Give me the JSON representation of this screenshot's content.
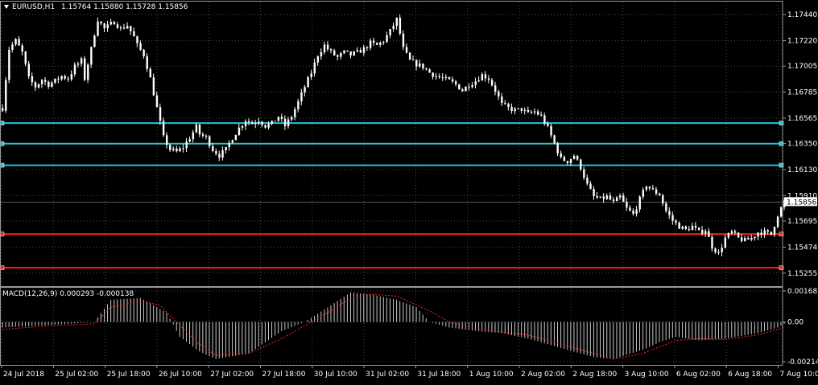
{
  "header": {
    "symbol": "EURUSD,H1",
    "ohlc": "1.15764 1.15880 1.15728 1.15856"
  },
  "colors": {
    "background": "#000000",
    "grid": "#4a4a4a",
    "candle": "#ffffff",
    "support": "#1fc6d6",
    "resistance": "#ff2020",
    "macd_signal": "#ff2020"
  },
  "chart_data": [
    {
      "type": "candlestick",
      "title": "EURUSD,H1",
      "ylim": [
        1.15145,
        1.1755
      ],
      "y_ticks": [
        "1.17440",
        "1.17220",
        "1.17005",
        "1.16785",
        "1.16565",
        "1.16350",
        "1.16130",
        "1.15910",
        "1.15695",
        "1.15474",
        "1.15255"
      ],
      "last_price": "1.15856",
      "x_ticks": [
        "24 Jul 2018",
        "25 Jul 02:00",
        "25 Jul 18:00",
        "26 Jul 10:00",
        "27 Jul 02:00",
        "27 Jul 18:00",
        "30 Jul 10:00",
        "31 Jul 02:00",
        "31 Jul 18:00",
        "1 Aug 10:00",
        "2 Aug 02:00",
        "2 Aug 18:00",
        "3 Aug 10:00",
        "6 Aug 02:00",
        "6 Aug 18:00",
        "7 Aug 10:00"
      ],
      "horizontal_lines": [
        {
          "price": 1.16523,
          "color": "support"
        },
        {
          "price": 1.16349,
          "color": "support"
        },
        {
          "price": 1.16167,
          "color": "support"
        },
        {
          "price": 1.15585,
          "color": "resistance"
        },
        {
          "price": 1.153,
          "color": "resistance"
        }
      ],
      "path": [
        [
          0,
          1.1665
        ],
        [
          2,
          1.1715
        ],
        [
          4,
          1.1722
        ],
        [
          6,
          1.1712
        ],
        [
          8,
          1.169
        ],
        [
          10,
          1.1683
        ],
        [
          12,
          1.1689
        ],
        [
          14,
          1.1685
        ],
        [
          16,
          1.1688
        ],
        [
          18,
          1.1692
        ],
        [
          20,
          1.169
        ],
        [
          22,
          1.17
        ],
        [
          24,
          1.1705
        ],
        [
          25,
          1.169
        ],
        [
          27,
          1.1715
        ],
        [
          28,
          1.1728
        ],
        [
          29,
          1.174
        ],
        [
          31,
          1.1732
        ],
        [
          34,
          1.1738
        ],
        [
          36,
          1.1732
        ],
        [
          38,
          1.1735
        ],
        [
          40,
          1.1725
        ],
        [
          41,
          1.1718
        ],
        [
          43,
          1.171
        ],
        [
          45,
          1.169
        ],
        [
          47,
          1.1665
        ],
        [
          49,
          1.164
        ],
        [
          51,
          1.163
        ],
        [
          53,
          1.1628
        ],
        [
          55,
          1.1632
        ],
        [
          57,
          1.164
        ],
        [
          59,
          1.1649
        ],
        [
          60,
          1.1643
        ],
        [
          62,
          1.164
        ],
        [
          64,
          1.163
        ],
        [
          66,
          1.1625
        ],
        [
          68,
          1.163
        ],
        [
          70,
          1.164
        ],
        [
          72,
          1.1648
        ],
        [
          74,
          1.1655
        ],
        [
          76,
          1.1652
        ],
        [
          78,
          1.1655
        ],
        [
          80,
          1.165
        ],
        [
          82,
          1.1652
        ],
        [
          84,
          1.1658
        ],
        [
          86,
          1.165
        ],
        [
          88,
          1.1658
        ],
        [
          90,
          1.167
        ],
        [
          92,
          1.1683
        ],
        [
          94,
          1.1695
        ],
        [
          96,
          1.171
        ],
        [
          98,
          1.1718
        ],
        [
          100,
          1.1712
        ],
        [
          102,
          1.1708
        ],
        [
          104,
          1.1712
        ],
        [
          106,
          1.171
        ],
        [
          108,
          1.1712
        ],
        [
          110,
          1.1715
        ],
        [
          112,
          1.172
        ],
        [
          114,
          1.1718
        ],
        [
          116,
          1.1722
        ],
        [
          118,
          1.173
        ],
        [
          120,
          1.174
        ],
        [
          121,
          1.1728
        ],
        [
          122,
          1.1715
        ],
        [
          124,
          1.1705
        ],
        [
          126,
          1.1702
        ],
        [
          128,
          1.17
        ],
        [
          130,
          1.1695
        ],
        [
          132,
          1.1692
        ],
        [
          134,
          1.169
        ],
        [
          136,
          1.1688
        ],
        [
          138,
          1.1685
        ],
        [
          140,
          1.168
        ],
        [
          142,
          1.1685
        ],
        [
          144,
          1.1688
        ],
        [
          146,
          1.1693
        ],
        [
          148,
          1.169
        ],
        [
          150,
          1.168
        ],
        [
          152,
          1.1668
        ],
        [
          154,
          1.1665
        ],
        [
          156,
          1.1663
        ],
        [
          158,
          1.1664
        ],
        [
          160,
          1.166
        ],
        [
          162,
          1.1662
        ],
        [
          164,
          1.1658
        ],
        [
          166,
          1.1648
        ],
        [
          168,
          1.1635
        ],
        [
          170,
          1.1622
        ],
        [
          172,
          1.162
        ],
        [
          174,
          1.1625
        ],
        [
          176,
          1.1615
        ],
        [
          178,
          1.16
        ],
        [
          180,
          1.159
        ],
        [
          182,
          1.1588
        ],
        [
          184,
          1.159
        ],
        [
          186,
          1.1585
        ],
        [
          188,
          1.159
        ],
        [
          190,
          1.158
        ],
        [
          192,
          1.1575
        ],
        [
          194,
          1.1588
        ],
        [
          196,
          1.16
        ],
        [
          198,
          1.1595
        ],
        [
          200,
          1.1592
        ],
        [
          202,
          1.1578
        ],
        [
          204,
          1.157
        ],
        [
          206,
          1.1565
        ],
        [
          208,
          1.1562
        ],
        [
          210,
          1.1565
        ],
        [
          212,
          1.156
        ],
        [
          214,
          1.1562
        ],
        [
          216,
          1.1548
        ],
        [
          218,
          1.1542
        ],
        [
          220,
          1.1555
        ],
        [
          222,
          1.156
        ],
        [
          224,
          1.1555
        ],
        [
          226,
          1.1553
        ],
        [
          228,
          1.1555
        ],
        [
          230,
          1.156
        ],
        [
          232,
          1.156
        ],
        [
          234,
          1.1558
        ],
        [
          236,
          1.1575
        ],
        [
          238,
          1.1586
        ]
      ]
    },
    {
      "type": "bar",
      "title": "MACD(12,26,9) 0.000293 -0.000138",
      "ylim": [
        -0.00232,
        0.00185
      ],
      "y_ticks": [
        "0.001682",
        "0.00",
        "-0.002149"
      ],
      "histogram_path": [
        [
          0,
          -0.0003
        ],
        [
          10,
          -0.0002
        ],
        [
          20,
          -0.0001
        ],
        [
          28,
          0.0
        ],
        [
          33,
          0.0012
        ],
        [
          42,
          0.0013
        ],
        [
          50,
          0.0005
        ],
        [
          54,
          -0.0008
        ],
        [
          60,
          -0.0016
        ],
        [
          65,
          -0.002
        ],
        [
          75,
          -0.0017
        ],
        [
          85,
          -0.0005
        ],
        [
          92,
          0.0
        ],
        [
          100,
          0.0009
        ],
        [
          106,
          0.0016
        ],
        [
          112,
          0.0015
        ],
        [
          120,
          0.0012
        ],
        [
          126,
          0.0008
        ],
        [
          130,
          0.0
        ],
        [
          136,
          -0.0003
        ],
        [
          145,
          -0.0005
        ],
        [
          152,
          -0.0006
        ],
        [
          160,
          -0.0009
        ],
        [
          170,
          -0.0014
        ],
        [
          180,
          -0.0019
        ],
        [
          186,
          -0.002
        ],
        [
          195,
          -0.0015
        ],
        [
          200,
          -0.0011
        ],
        [
          205,
          -0.0008
        ],
        [
          212,
          -0.001
        ],
        [
          220,
          -0.0009
        ],
        [
          230,
          -0.0006
        ],
        [
          236,
          -0.0003
        ],
        [
          238,
          -0.0001
        ]
      ],
      "signal_path": [
        [
          0,
          -0.0004
        ],
        [
          15,
          -0.0002
        ],
        [
          28,
          -0.0001
        ],
        [
          33,
          0.0008
        ],
        [
          42,
          0.00115
        ],
        [
          48,
          0.0009
        ],
        [
          54,
          -0.0002
        ],
        [
          60,
          -0.0012
        ],
        [
          65,
          -0.0018
        ],
        [
          75,
          -0.0017
        ],
        [
          85,
          -0.0009
        ],
        [
          92,
          -0.0002
        ],
        [
          100,
          0.0006
        ],
        [
          106,
          0.0013
        ],
        [
          112,
          0.0015
        ],
        [
          120,
          0.0014
        ],
        [
          130,
          0.0006
        ],
        [
          136,
          0.0
        ],
        [
          145,
          -0.0004
        ],
        [
          160,
          -0.0007
        ],
        [
          170,
          -0.0012
        ],
        [
          180,
          -0.0017
        ],
        [
          186,
          -0.002
        ],
        [
          195,
          -0.0017
        ],
        [
          205,
          -0.001
        ],
        [
          212,
          -0.0009
        ],
        [
          220,
          -0.00095
        ],
        [
          230,
          -0.0007
        ],
        [
          238,
          -0.0003
        ]
      ]
    }
  ]
}
